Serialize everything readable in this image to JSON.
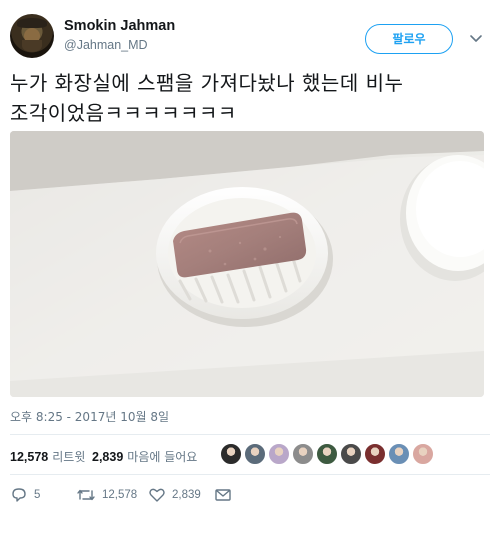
{
  "user": {
    "display_name": "Smokin Jahman",
    "handle": "@Jahman_MD"
  },
  "follow_button": {
    "label": "팔로우"
  },
  "tweet": {
    "text_line1": "누가 화장실에 스팸을 가져다놨나 했는데 비누",
    "text_line2": "조각이었음ㅋㅋㅋㅋㅋㅋㅋ"
  },
  "timestamp": "오후 8:25 - 2017년 10월 8일",
  "stats": {
    "retweets_count": "12,578",
    "retweets_label": "리트윗",
    "likes_count": "2,839",
    "likes_label": "마음에 들어요",
    "liker_colors": [
      "#2b2b2b",
      "#5b6b7a",
      "#b9a7c9",
      "#8c8c8c",
      "#3d5a40",
      "#4a4a4a",
      "#7a2f2f",
      "#6a8fb5",
      "#d9a7a0"
    ]
  },
  "actions": {
    "reply_count": "5",
    "retweet_count": "12,578",
    "like_count": "2,839"
  },
  "icons": {
    "reply": "reply-icon",
    "retweet": "retweet-icon",
    "like": "heart-icon",
    "message": "envelope-icon",
    "more": "chevron-down-icon"
  },
  "colors": {
    "accent": "#1da1f2",
    "muted": "#657786",
    "text": "#14171a"
  }
}
